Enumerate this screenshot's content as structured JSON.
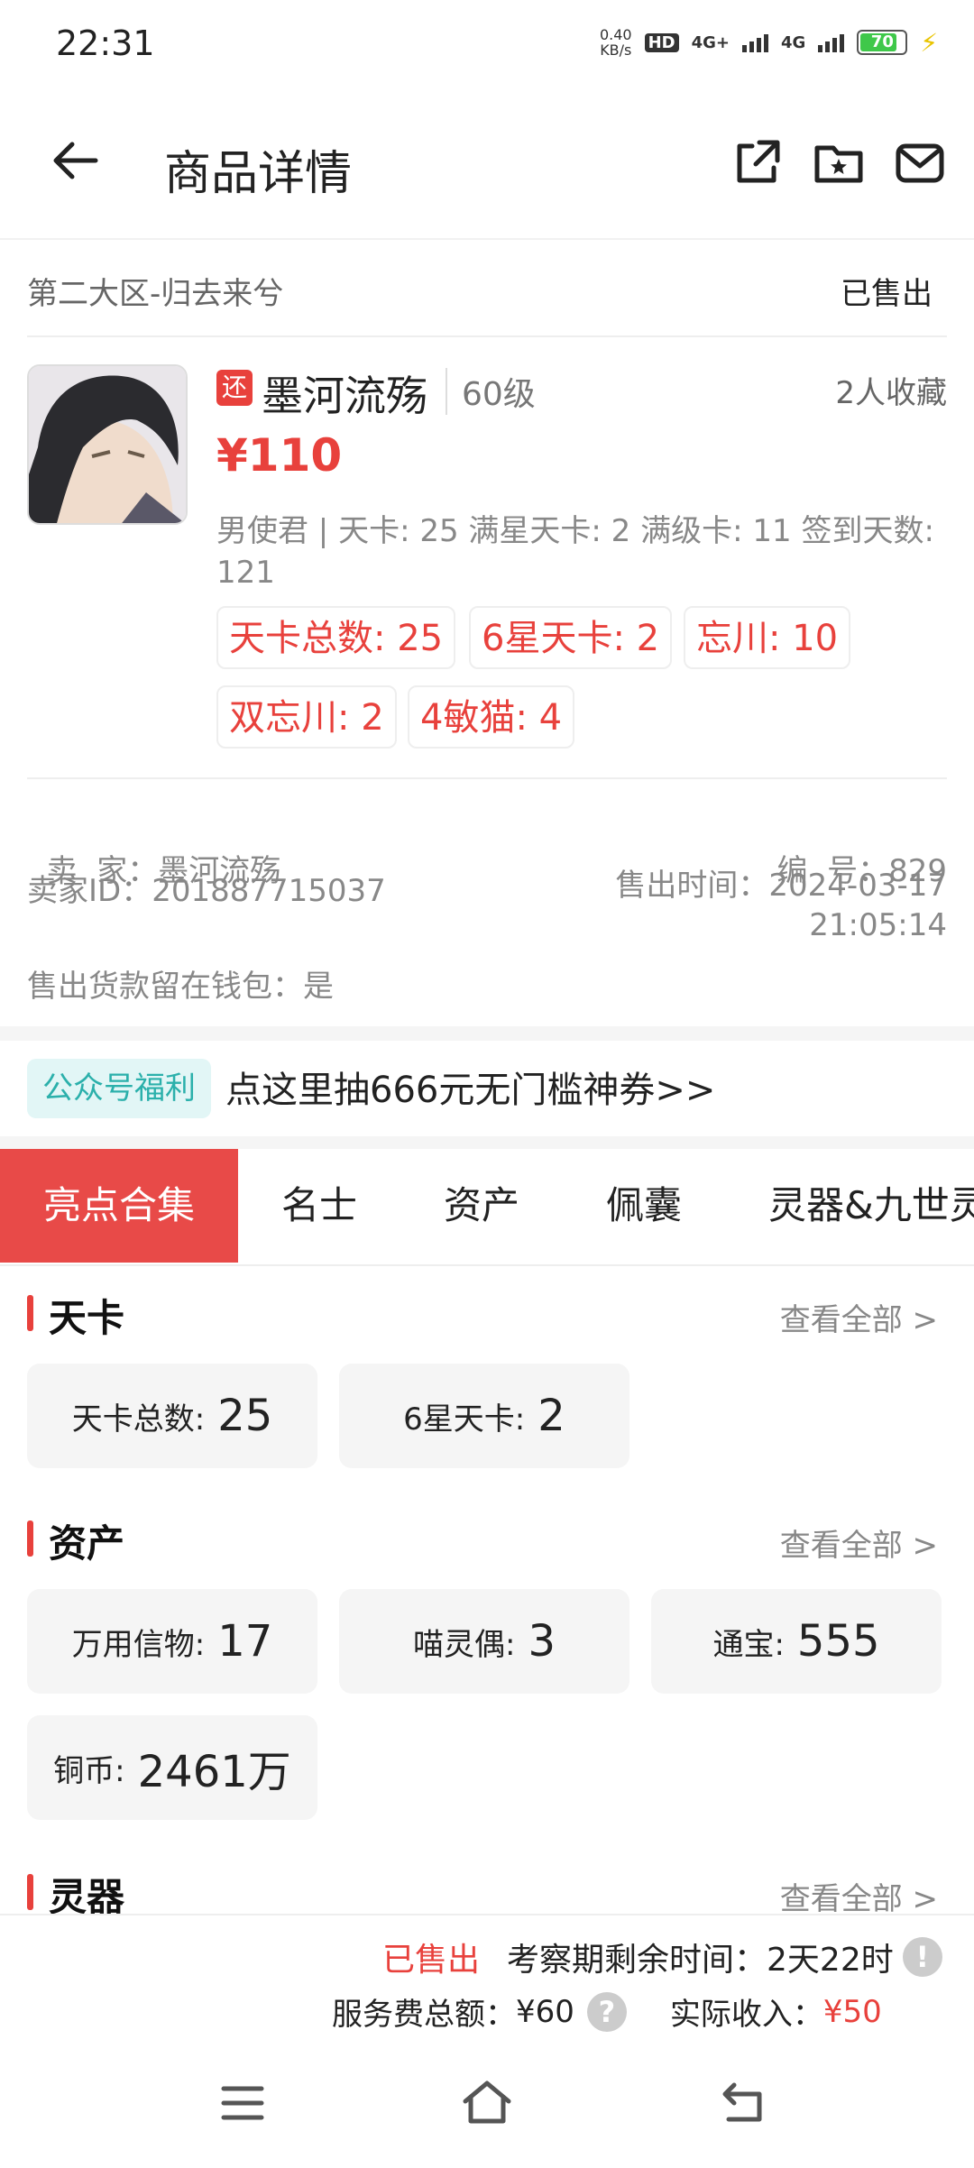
{
  "status_bar": {
    "time": "22:31",
    "net_speed_value": "0.40",
    "net_speed_unit": "KB/s",
    "hd": "HD",
    "sig1": "4G+",
    "sig2": "4G",
    "battery": "70"
  },
  "header": {
    "title": "商品详情"
  },
  "listing": {
    "region": "第二大区-归去来兮",
    "status": "已售出",
    "return_tag": "还",
    "name": "墨河流殇",
    "level": "60级",
    "favorites": "2人收藏",
    "price": "¥110",
    "description": "男使君 | 天卡: 25 满星天卡: 2 满级卡: 11 签到天数: 121",
    "chips": [
      "天卡总数: 25",
      "6星天卡: 2",
      "忘川: 10",
      "双忘川: 2",
      "4敏猫: 4"
    ]
  },
  "seller": {
    "seller_label": "卖  家：",
    "seller_value": "墨河流殇",
    "id_label": "卖家ID：",
    "id_value": "201887715037",
    "number_label": "编  号：",
    "number_value": "829",
    "sold_time_label": "售出时间：",
    "sold_date": "2024-03-17",
    "sold_clock": "21:05:14",
    "wallet": "售出货款留在钱包：是"
  },
  "promo": {
    "tag": "公众号福利",
    "text": "点这里抽666元无门槛神券>>"
  },
  "tabs": [
    "亮点合集",
    "名士",
    "资产",
    "佩囊",
    "灵器&九世灵"
  ],
  "sections": {
    "tianka": {
      "title": "天卡",
      "more": "查看全部 >",
      "cards": [
        {
          "k": "天卡总数:",
          "v": "25"
        },
        {
          "k": "6星天卡:",
          "v": "2"
        }
      ]
    },
    "assets": {
      "title": "资产",
      "more": "查看全部 >",
      "cards": [
        {
          "k": "万用信物:",
          "v": "17"
        },
        {
          "k": "喵灵偶:",
          "v": "3"
        },
        {
          "k": "通宝:",
          "v": "555"
        },
        {
          "k": "铜币:",
          "v": "2461万"
        }
      ]
    },
    "lingqi": {
      "title": "灵器",
      "more": "查看全部 >"
    }
  },
  "bottom": {
    "sold": "已售出",
    "remaining_label": "考察期剩余时间：",
    "remaining_value": "2天22时",
    "fee_label": "服务费总额：",
    "fee_value": "¥60",
    "income_label": "实际收入：",
    "income_value": "¥50"
  },
  "colors": {
    "accent": "#e8413c",
    "tab_active": "#e84a48",
    "promo_bg": "#e2f6f6",
    "promo_fg": "#2bb0ab"
  }
}
